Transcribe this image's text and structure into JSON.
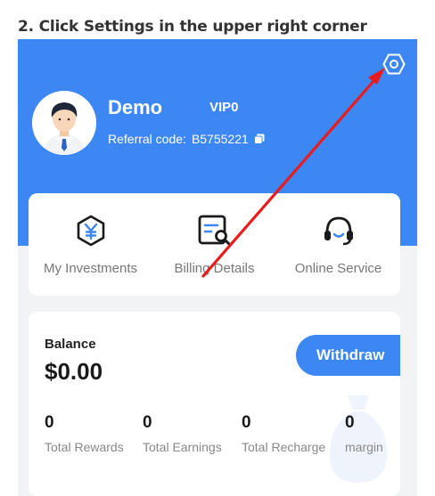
{
  "instruction": "2. Click Settings in the upper right corner",
  "header": {
    "username": "Demo",
    "vip_level": "VIP0",
    "referral_label": "Referral code:",
    "referral_code": "B5755221"
  },
  "menu": [
    {
      "label": "My Investments",
      "icon": "yuan-hexagon-icon"
    },
    {
      "label": "Billing Details",
      "icon": "bill-search-icon"
    },
    {
      "label": "Online Service",
      "icon": "headset-icon"
    }
  ],
  "balance": {
    "label": "Balance",
    "value": "$0.00",
    "withdraw_label": "Withdraw",
    "stats": [
      {
        "value": "0",
        "label": "Total Rewards"
      },
      {
        "value": "0",
        "label": "Total Earnings"
      },
      {
        "value": "0",
        "label": "Total Recharge"
      },
      {
        "value": "0",
        "label": "margin"
      }
    ]
  },
  "colors": {
    "primary": "#3d87f5",
    "annotation_arrow": "#e81c1c",
    "background": "#f2f3f5"
  }
}
